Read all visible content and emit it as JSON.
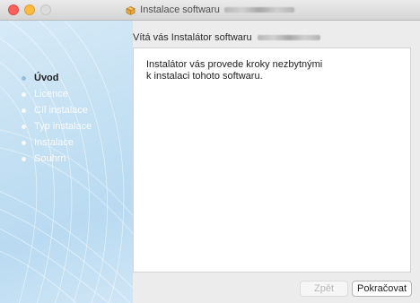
{
  "window": {
    "title": "Instalace softwaru",
    "title_icon": "package-icon"
  },
  "sidebar": {
    "steps": [
      {
        "label": "Úvod",
        "active": true
      },
      {
        "label": "Licence",
        "active": false
      },
      {
        "label": "Cíl instalace",
        "active": false
      },
      {
        "label": "Typ instalace",
        "active": false
      },
      {
        "label": "Instalace",
        "active": false
      },
      {
        "label": "Souhrn",
        "active": false
      }
    ]
  },
  "main": {
    "heading": "Vítá vás Instalátor softwaru",
    "body_line1": "Instalátor vás provede kroky nezbytnými",
    "body_line2": "k instalaci tohoto softwaru."
  },
  "buttons": {
    "back": "Zpět",
    "continue": "Pokračovat"
  },
  "colors": {
    "close": "#fc605c",
    "minimize": "#fdbc40",
    "zoom_disabled": "#dcdcdc",
    "sidebar_blue": "#c4e0f3"
  }
}
